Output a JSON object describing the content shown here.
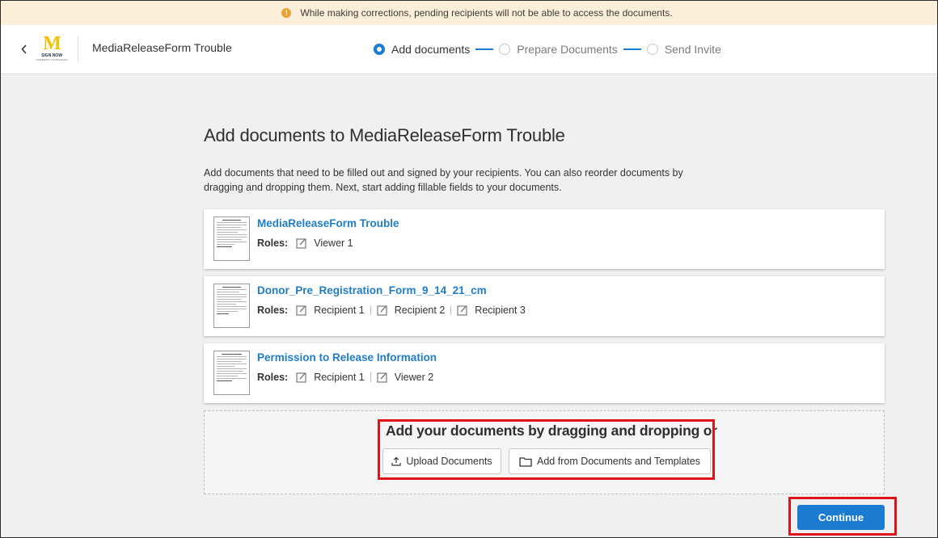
{
  "banner": {
    "icon": "warning-icon",
    "text": "While making corrections, pending recipients will not be able to access the documents."
  },
  "header": {
    "back_icon": "chevron-left-icon",
    "logo": {
      "letter": "M",
      "line1": "SIGN NOW",
      "line2": "UNIVERSITY OF MICHIGAN"
    },
    "document_title": "MediaReleaseForm Trouble",
    "steps": [
      {
        "label": "Add documents",
        "active": true
      },
      {
        "label": "Prepare Documents",
        "active": false
      },
      {
        "label": "Send Invite",
        "active": false
      }
    ]
  },
  "main": {
    "heading": "Add documents to MediaReleaseForm Trouble",
    "description": "Add documents that need to be filled out and signed by your recipients. You can also reorder documents by dragging and dropping them. Next, start adding fillable fields to your documents.",
    "roles_label": "Roles:",
    "documents": [
      {
        "title": "MediaReleaseForm Trouble",
        "roles": [
          "Viewer 1"
        ]
      },
      {
        "title": "Donor_Pre_Registration_Form_9_14_21_cm",
        "roles": [
          "Recipient 1",
          "Recipient 2",
          "Recipient 3"
        ]
      },
      {
        "title": "Permission to Release Information",
        "roles": [
          "Recipient 1",
          "Viewer 2"
        ]
      }
    ],
    "dropzone": {
      "text": "Add your documents by dragging and dropping or",
      "upload_label": "Upload Documents",
      "add_from_label": "Add from Documents and Templates"
    },
    "continue_label": "Continue"
  },
  "colors": {
    "accent": "#1a7bd0",
    "highlight": "#e0131d",
    "banner_bg": "#fcefd9",
    "logo": "#f2c200"
  }
}
